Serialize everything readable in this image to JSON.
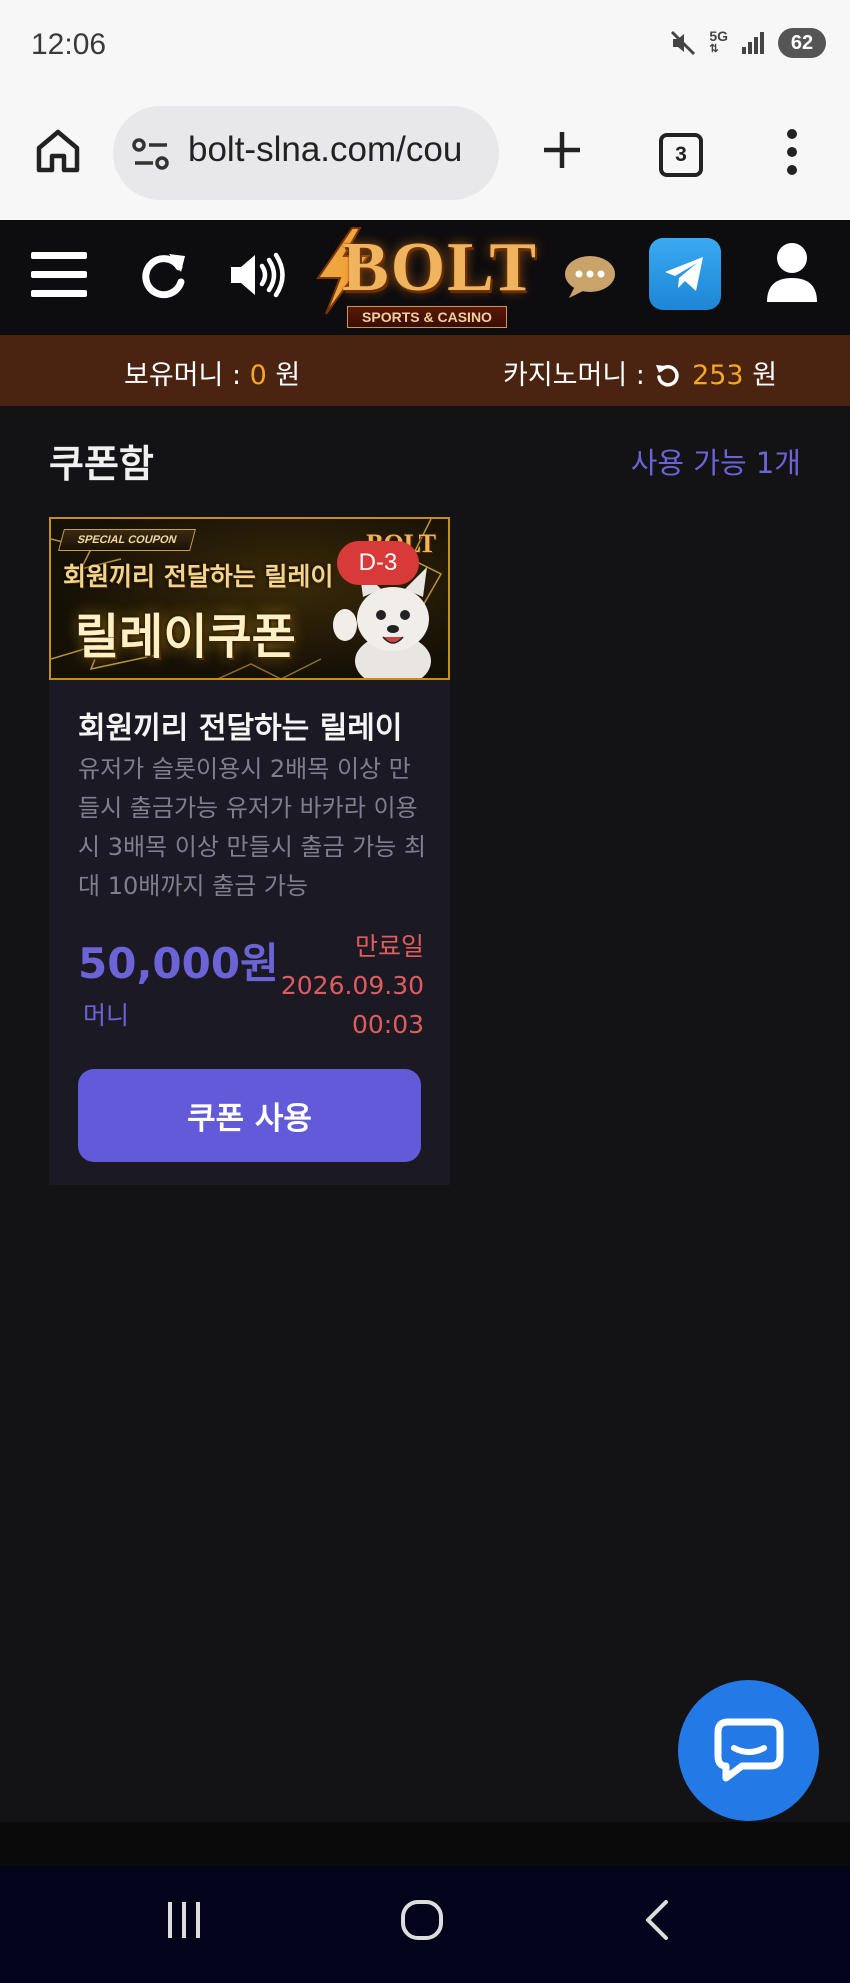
{
  "status_bar": {
    "time": "12:06",
    "network": "5G",
    "battery": "62"
  },
  "browser": {
    "url": "bolt-slna.com/cou",
    "tab_count": "3"
  },
  "header": {
    "logo_text": "BOLT",
    "logo_subtitle": "SPORTS & CASINO"
  },
  "money_bar": {
    "holding_label": "보유머니 :",
    "holding_value": "0",
    "holding_unit": "원",
    "casino_label": "카지노머니 :",
    "casino_value": "253",
    "casino_unit": "원"
  },
  "coupon_box": {
    "title": "쿠폰함",
    "available": "사용 가능 1개"
  },
  "coupon": {
    "banner_ribbon": "SPECIAL COUPON",
    "banner_line1": "회원끼리 전달하는 릴레이",
    "banner_line2": "릴레이쿠폰",
    "banner_brand": "BOLT",
    "dday": "D-3",
    "name": "회원끼리 전달하는 릴레이",
    "description": "유저가 슬롯이용시 2배목 이상 만들시 출금가능 유저가 바카라 이용시 3배목 이상 만들시 출금 가능 최대 10배까지 출금 가능",
    "amount": "50,000원",
    "amount_type": "머니",
    "expiry_label": "만료일",
    "expiry_date": "2026.09.30",
    "expiry_time": "00:03",
    "use_button": "쿠폰 사용"
  },
  "colors": {
    "accent": "#625ad8",
    "money_bar": "#4a2410",
    "money_value": "#f5a623",
    "expiry": "#e05b5b",
    "chat_fab": "#2379e6"
  }
}
